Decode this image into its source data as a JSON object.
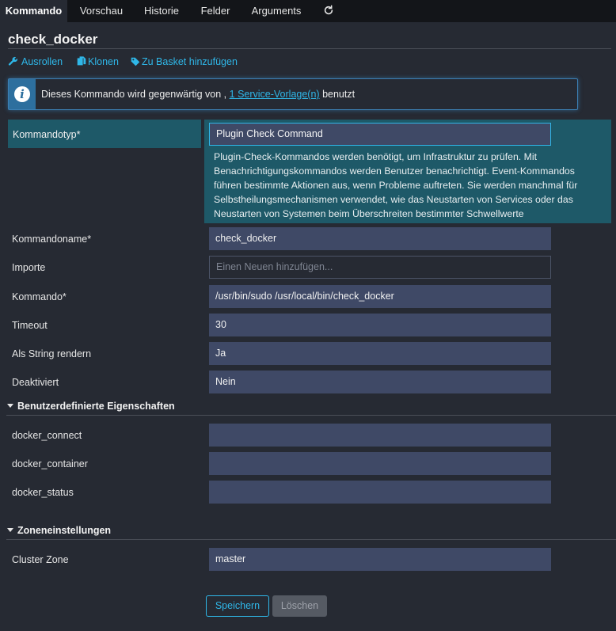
{
  "tabs": [
    {
      "label": "Kommando",
      "active": true
    },
    {
      "label": "Vorschau"
    },
    {
      "label": "Historie"
    },
    {
      "label": "Felder"
    },
    {
      "label": "Arguments"
    }
  ],
  "refresh_icon": "refresh-icon",
  "page_title": "check_docker",
  "actions": {
    "rollout": {
      "label": "Ausrollen",
      "icon": "wrench-icon"
    },
    "clone": {
      "label": "Klonen",
      "icon": "copy-icon"
    },
    "basket": {
      "label": "Zu Basket hinzufügen",
      "icon": "tag-icon"
    }
  },
  "info": {
    "prefix": "Dieses Kommando wird gegenwärtig von ,",
    "link": "1 Service-Vorlage(n)",
    "suffix": "benutzt"
  },
  "command_type": {
    "label": "Kommandotyp*",
    "value": "Plugin Check Command",
    "description": "Plugin-Check-Kommandos werden benötigt, um Infrastruktur zu prüfen. Mit Benachrichtigungskommandos werden Benutzer benachrichtigt. Event-Kommandos führen bestimmte Aktionen aus, wenn Probleme auftreten. Sie werden manchmal für Selbstheilungsmechanismen verwendet, wie das Neustarten von Services oder das Neustarten von Systemen beim Überschreiten bestimmter Schwellwerte"
  },
  "fields": {
    "name": {
      "label": "Kommandoname*",
      "value": "check_docker"
    },
    "imports": {
      "label": "Importe",
      "placeholder": "Einen Neuen hinzufügen..."
    },
    "command": {
      "label": "Kommando*",
      "value": "/usr/bin/sudo /usr/local/bin/check_docker"
    },
    "timeout": {
      "label": "Timeout",
      "value": "30"
    },
    "render_string": {
      "label": "Als String rendern",
      "value": "Ja"
    },
    "disabled": {
      "label": "Deaktiviert",
      "value": "Nein"
    }
  },
  "custom_props": {
    "title": "Benutzerdefinierte Eigenschaften",
    "items": [
      {
        "label": "docker_connect",
        "value": ""
      },
      {
        "label": "docker_container",
        "value": ""
      },
      {
        "label": "docker_status",
        "value": ""
      }
    ]
  },
  "zone": {
    "title": "Zoneneinstellungen",
    "cluster_zone": {
      "label": "Cluster Zone",
      "value": "master"
    }
  },
  "buttons": {
    "save": "Speichern",
    "delete": "Löschen"
  },
  "colors": {
    "accent": "#2fb7e8",
    "highlight": "#1e5968",
    "field": "#3f4966",
    "background": "#262a33",
    "tabbar": "#131519"
  }
}
